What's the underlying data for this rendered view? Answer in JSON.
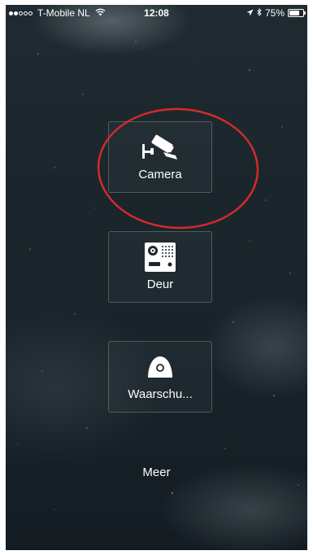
{
  "status_bar": {
    "carrier": "T-Mobile NL",
    "time": "12:08",
    "battery": "75%",
    "battery_level": 0.75,
    "signal_bars_filled": 2,
    "signal_bars_total": 5
  },
  "menu": {
    "items": [
      {
        "label": "Camera",
        "icon": "security-camera-icon"
      },
      {
        "label": "Deur",
        "icon": "door-intercom-icon"
      },
      {
        "label": "Waarschu...",
        "icon": "alarm-sensor-icon"
      }
    ],
    "more_label": "Meer"
  },
  "annotation": {
    "shape": "ellipse",
    "color": "#d42a2a",
    "target": "Camera"
  },
  "colors": {
    "background": "#1c272d",
    "text": "#ffffff",
    "tile_border": "rgba(255,255,255,0.22)"
  }
}
